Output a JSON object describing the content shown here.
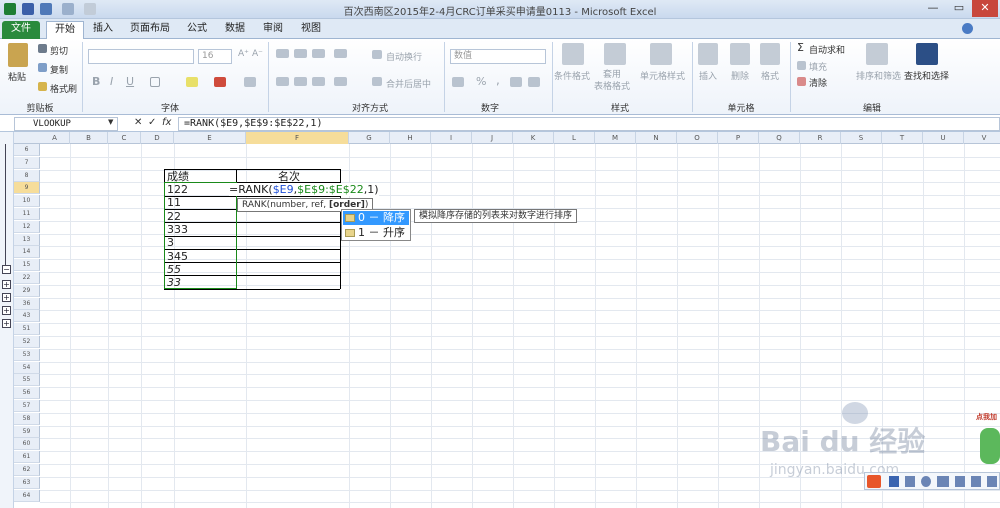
{
  "window": {
    "title": "百次西南区2015年2-4月CRC订单采买申请量0113 - Microsoft Excel",
    "minimize": "—",
    "maximize": "▭",
    "close": "✕"
  },
  "tabs": [
    "文件",
    "开始",
    "插入",
    "页面布局",
    "公式",
    "数据",
    "审阅",
    "视图"
  ],
  "ribbon": {
    "clipboard": {
      "paste": "粘贴",
      "cut": "剪切",
      "copy": "复制",
      "format_painter": "格式刷",
      "label": "剪贴板"
    },
    "font": {
      "size": "16",
      "bold": "B",
      "italic": "I",
      "underline": "U",
      "label": "字体"
    },
    "alignment": {
      "wrap": "自动换行",
      "merge": "合并后居中",
      "label": "对齐方式"
    },
    "number": {
      "format": "数值",
      "percent": "%",
      "comma": ",",
      "label": "数字"
    },
    "styles": {
      "conditional": "条件格式",
      "table_format": "套用\n表格格式",
      "cell_styles": "单元格样式",
      "label": "样式"
    },
    "cells": {
      "insert": "插入",
      "delete": "删除",
      "format": "格式",
      "label": "单元格"
    },
    "editing": {
      "autosum": "自动求和",
      "fill": "填充",
      "clear": "清除",
      "sort_filter": "排序和筛选",
      "find_select": "查找和选择",
      "label": "编辑"
    }
  },
  "formula_bar": {
    "name_box": "VLOOKUP",
    "cancel": "✕",
    "enter": "✓",
    "fx": "fx",
    "formula": "=RANK($E9,$E$9:$E$22,1)"
  },
  "columns": [
    "A",
    "B",
    "C",
    "D",
    "E",
    "F",
    "G",
    "H",
    "I",
    "J",
    "K",
    "L",
    "M",
    "N",
    "O",
    "P",
    "Q",
    "R",
    "S",
    "T",
    "U",
    "V",
    "W"
  ],
  "rows": [
    "6",
    "7",
    "8",
    "9",
    "10",
    "11",
    "12",
    "13",
    "14",
    "15",
    "22",
    "29",
    "36",
    "43",
    "51",
    "52",
    "53",
    "54",
    "55",
    "56",
    "57",
    "58",
    "59",
    "60",
    "61",
    "62",
    "63",
    "64",
    "65",
    "66"
  ],
  "table": {
    "header_score": "成绩",
    "header_rank": "名次",
    "scores": [
      "122",
      "11",
      "22",
      "333",
      "3",
      "345",
      "55",
      "33"
    ],
    "editing_formula_prefix": "=RANK(",
    "editing_formula_ref1": "$E9",
    "editing_formula_sep": ",",
    "editing_formula_ref2": "$E$9:$E$22",
    "editing_formula_suffix": ",1)"
  },
  "tooltip": {
    "signature_pre": "RANK(number, ref, ",
    "signature_bold": "[order]",
    "signature_post": ")"
  },
  "autocomplete": {
    "options": [
      "0 － 降序",
      "1 － 升序"
    ],
    "hint": "模拟降序存储的列表来对数字进行排序"
  },
  "watermark": {
    "brand": "Bai du 经验",
    "url": "jingyan.baidu.com"
  },
  "taskbar_badge": "点我加",
  "colors": {
    "accent_green": "#2a8a3c",
    "selection_blue": "#3399ff",
    "ref_blue": "#1f4fd6",
    "ref_green": "#1a8a1a"
  }
}
